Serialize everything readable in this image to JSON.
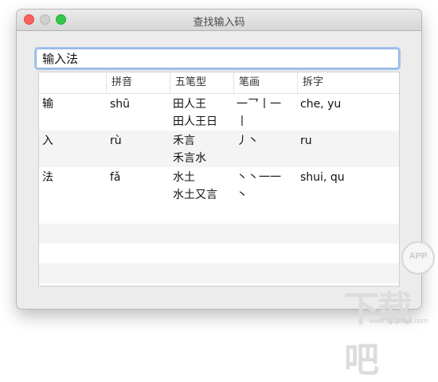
{
  "window": {
    "title": "查找输入码"
  },
  "search": {
    "value": "输入法"
  },
  "table": {
    "headers": [
      "",
      "拼音",
      "五笔型",
      "笔画",
      "拆字"
    ],
    "rows": [
      {
        "char": "输",
        "pinyin": "shū",
        "wubi": "田人王\n田人王日",
        "strokes": "一乛丨一\n丨",
        "chaizi": "che, yu"
      },
      {
        "char": "入",
        "pinyin": "rù",
        "wubi": "禾言\n禾言水",
        "strokes": "丿丶",
        "chaizi": "ru"
      },
      {
        "char": "法",
        "pinyin": "fǎ",
        "wubi": "水土\n水土又言",
        "strokes": "丶丶一一\n丶",
        "chaizi": "shui, qu"
      }
    ]
  },
  "watermark": {
    "logo": "APP",
    "text": "下载吧",
    "url": "www.xiazaiba.com"
  }
}
